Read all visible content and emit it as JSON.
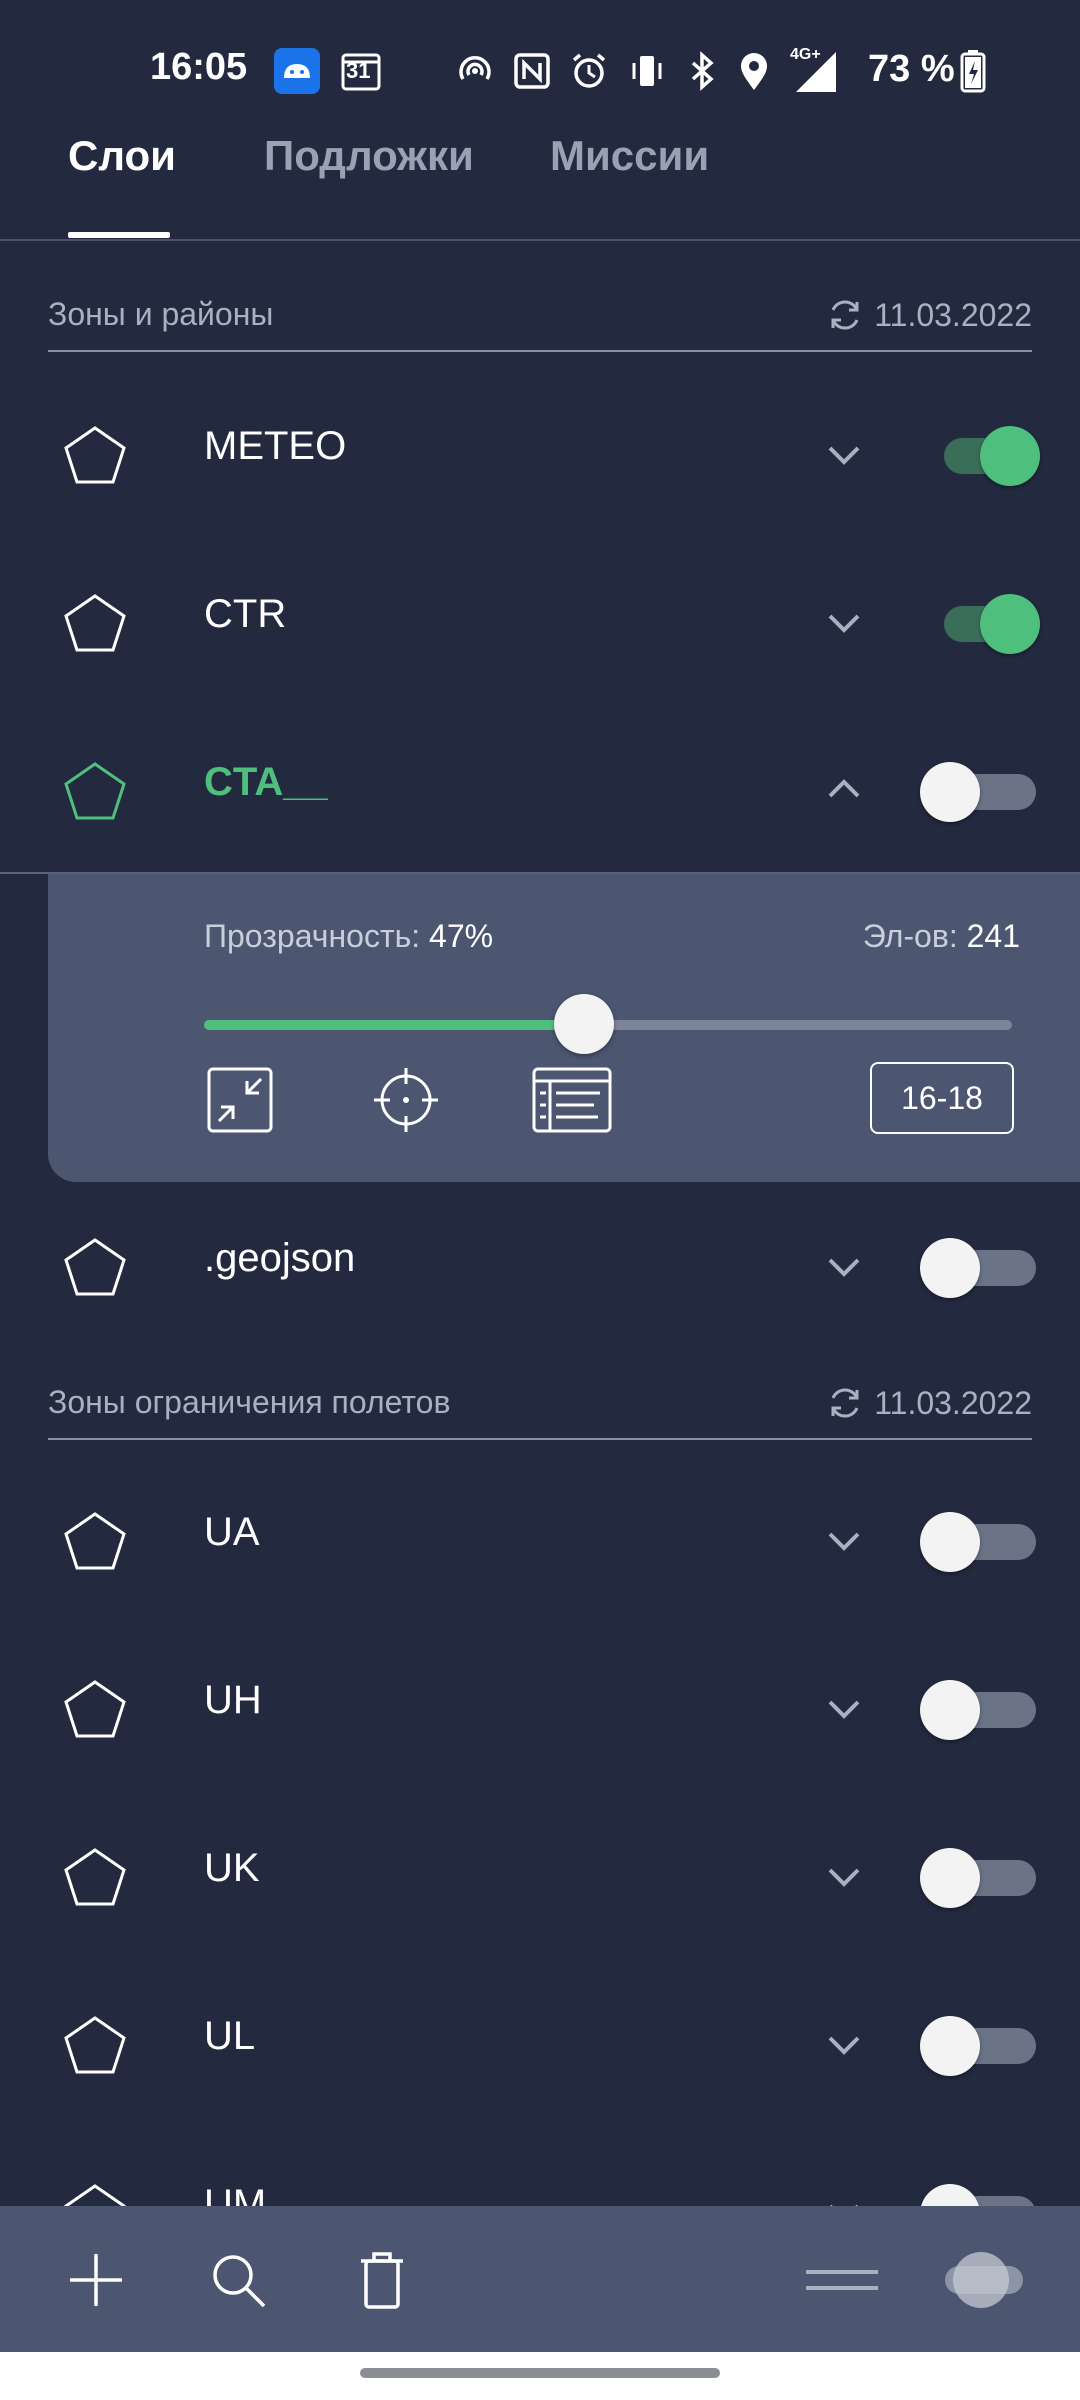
{
  "status_bar": {
    "time": "16:05",
    "calendar_day": "31",
    "network": "4G+",
    "battery": "73 %"
  },
  "tabs": [
    {
      "label": "Слои",
      "active": true
    },
    {
      "label": "Подложки",
      "active": false
    },
    {
      "label": "Миссии",
      "active": false
    }
  ],
  "sections": [
    {
      "title": "Зоны и районы",
      "date": "11.03.2022",
      "layers": [
        {
          "name": "METEO",
          "enabled": true,
          "expanded": false
        },
        {
          "name": "CTR",
          "enabled": true,
          "expanded": false
        },
        {
          "name": "CTA__",
          "enabled": false,
          "expanded": true
        },
        {
          "name": ".geojson",
          "enabled": false,
          "expanded": false
        }
      ]
    },
    {
      "title": "Зоны ограничения полетов",
      "date": "11.03.2022",
      "layers": [
        {
          "name": "UA",
          "enabled": false,
          "expanded": false
        },
        {
          "name": "UH",
          "enabled": false,
          "expanded": false
        },
        {
          "name": "UK",
          "enabled": false,
          "expanded": false
        },
        {
          "name": "UL",
          "enabled": false,
          "expanded": false
        },
        {
          "name": "UM",
          "enabled": false,
          "expanded": false
        }
      ]
    }
  ],
  "expanded_panel": {
    "opacity_label": "Прозрачность:",
    "opacity_value": "47%",
    "opacity_fraction": 0.47,
    "elements_label": "Эл-ов:",
    "elements_value": "241",
    "range_button": "16-18",
    "icons": [
      "collapse-icon",
      "crosshair-icon",
      "list-icon"
    ]
  },
  "bottom_bar": {
    "icons": [
      "plus-icon",
      "search-icon",
      "trash-icon",
      "drag-handle-icon",
      "toggle-icon"
    ]
  },
  "colors": {
    "background": "#232a3f",
    "panel": "#4c5670",
    "accent_green": "#4fbf7e",
    "muted_text": "#a9b0c0"
  }
}
